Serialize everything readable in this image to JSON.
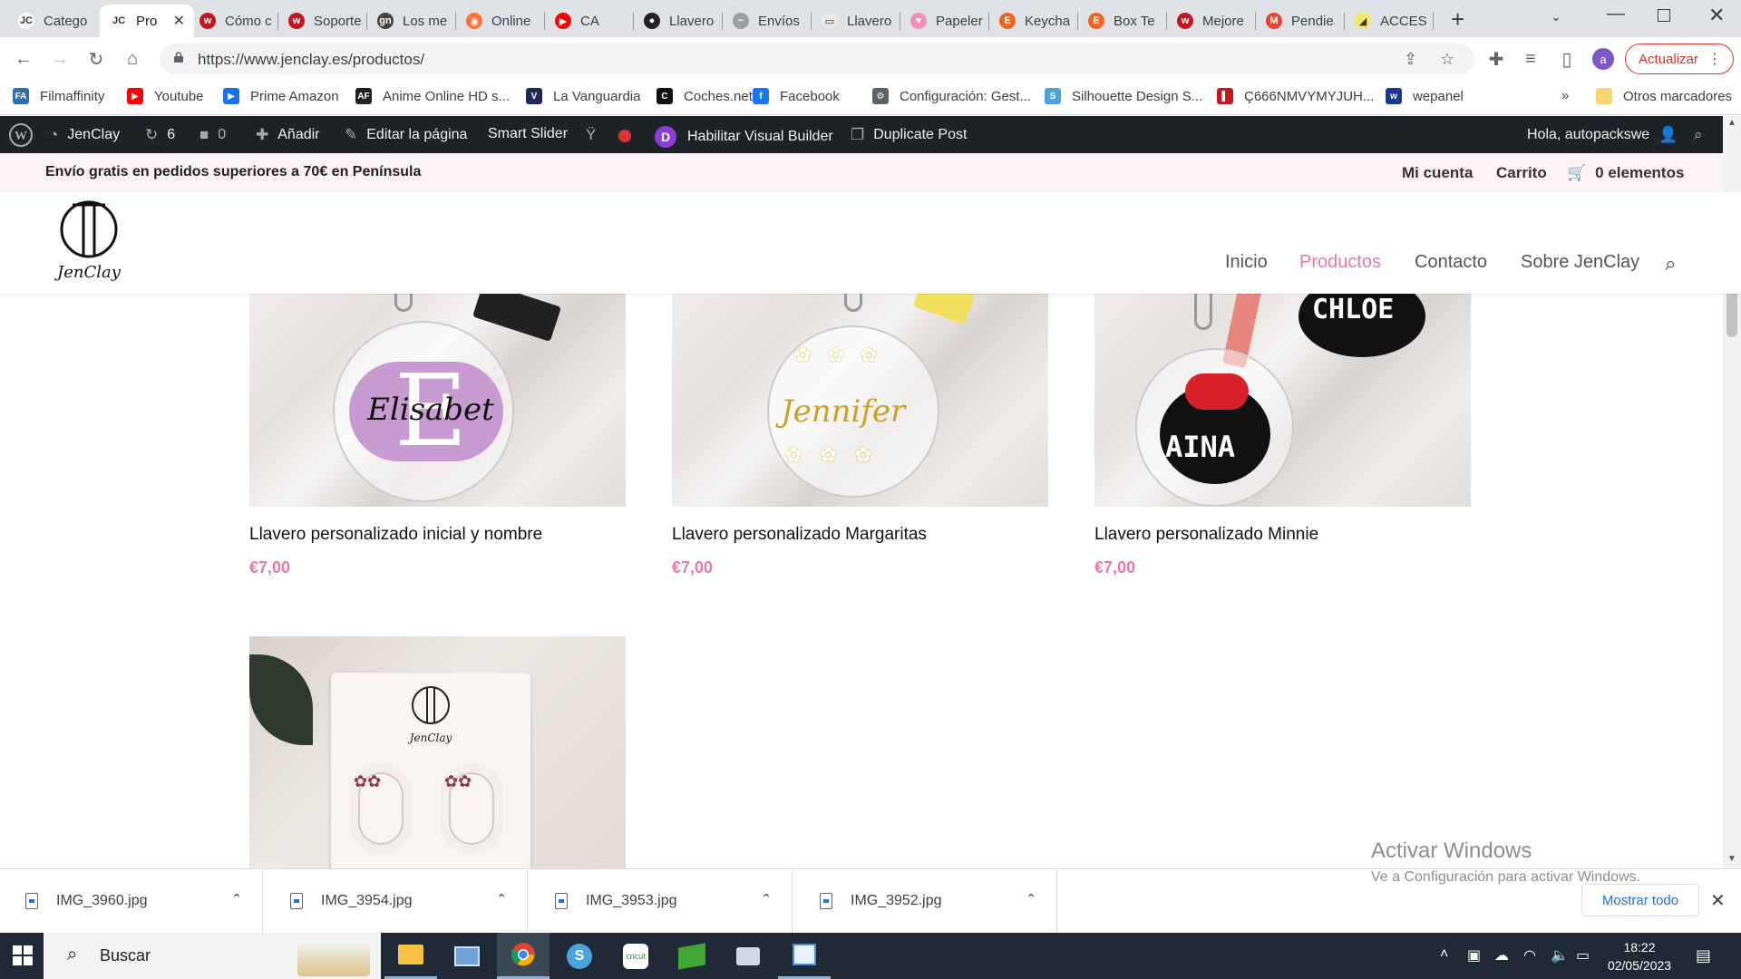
{
  "browser": {
    "tabs": [
      {
        "title": "Catego",
        "color": "#ffffff",
        "glyph": "JC",
        "active": false
      },
      {
        "title": "Pro",
        "color": "#ffffff",
        "glyph": "JC",
        "active": true
      },
      {
        "title": "Cómo c",
        "color": "#c4161c",
        "glyph": "w",
        "active": false
      },
      {
        "title": "Soporte",
        "color": "#c4161c",
        "glyph": "w",
        "active": false
      },
      {
        "title": "Los me",
        "color": "#444444",
        "glyph": "gn",
        "active": false
      },
      {
        "title": "Online",
        "color": "#ff7139",
        "glyph": "◉",
        "active": false
      },
      {
        "title": "CA",
        "color": "#ff0000",
        "glyph": "▶",
        "active": false
      },
      {
        "title": "Llavero",
        "color": "#222222",
        "glyph": "●",
        "active": false
      },
      {
        "title": "Envíos",
        "color": "#9aa0a6",
        "glyph": "~",
        "active": false
      },
      {
        "title": "Llavero",
        "color": "#e8e8e8",
        "glyph": "▭",
        "active": false
      },
      {
        "title": "Papeler",
        "color": "#f48fb1",
        "glyph": "♥",
        "active": false
      },
      {
        "title": "Keycha",
        "color": "#f16521",
        "glyph": "E",
        "active": false
      },
      {
        "title": "Box Te",
        "color": "#f16521",
        "glyph": "E",
        "active": false
      },
      {
        "title": "Mejore",
        "color": "#c4161c",
        "glyph": "w",
        "active": false
      },
      {
        "title": "Pendie",
        "color": "#ea4335",
        "glyph": "M",
        "active": false
      },
      {
        "title": "ACCES",
        "color": "#f5e663",
        "glyph": "◢",
        "active": false
      }
    ],
    "new_tab": "+",
    "url": "https://www.jenclay.es/productos/",
    "update_label": "Actualizar",
    "profile_initial": "a",
    "bookmarks": [
      {
        "label": "Filmaffinity",
        "color": "#2d6db5",
        "glyph": "FA"
      },
      {
        "label": "Youtube",
        "color": "#ff0000",
        "glyph": "▶"
      },
      {
        "label": "Prime Amazon",
        "color": "#1a73e8",
        "glyph": "▶"
      },
      {
        "label": "Anime Online HD s...",
        "color": "#222222",
        "glyph": "AF"
      },
      {
        "label": "La Vanguardia",
        "color": "#1e2a56",
        "glyph": "V"
      },
      {
        "label": "Coches.net",
        "color": "#111111",
        "glyph": "C"
      },
      {
        "label": "Facebook",
        "color": "#1877f2",
        "glyph": "f"
      },
      {
        "label": "Configuración: Gest...",
        "color": "#5f6368",
        "glyph": "⚙"
      },
      {
        "label": "Silhouette Design S...",
        "color": "#4aa3df",
        "glyph": "S"
      },
      {
        "label": "Ç666NMVYMYJUH...",
        "color": "#c4161c",
        "glyph": "▌"
      },
      {
        "label": "wepanel",
        "color": "#1b3a8f",
        "glyph": "w"
      }
    ],
    "bookmarks_more": "»",
    "other_bookmarks": "Otros marcadores"
  },
  "wpbar": {
    "site_name": "JenClay",
    "updates": "6",
    "comments": "0",
    "add_new": "Añadir",
    "edit_page": "Editar la página",
    "smart_slider": "Smart Slider",
    "visual_builder": "Habilitar Visual Builder",
    "duplicate": "Duplicate Post",
    "greeting": "Hola, autopackswe"
  },
  "site": {
    "promo": "Envío gratis en pedidos superiores a 70€ en Península",
    "account": "Mi cuenta",
    "cart": "Carrito",
    "cart_count": "0 elementos",
    "logo_text": "JenClay",
    "menu": [
      {
        "label": "Inicio",
        "active": false
      },
      {
        "label": "Productos",
        "active": true
      },
      {
        "label": "Contacto",
        "active": false
      },
      {
        "label": "Sobre JenClay",
        "active": false
      }
    ],
    "accent": "#e879aa"
  },
  "products": [
    {
      "title": "Llavero personalizado inicial y nombre",
      "price": "€7,00",
      "image_text": "Elisabet",
      "image_letter": "E"
    },
    {
      "title": "Llavero personalizado Margaritas",
      "price": "€7,00",
      "image_text": "Jennifer"
    },
    {
      "title": "Llavero personalizado Minnie",
      "price": "€7,00",
      "image_text": "AINA",
      "image_text2": "CHLOE"
    },
    {
      "title": "",
      "price": "",
      "image_text": "JenClay"
    }
  ],
  "watermark": {
    "line1": "Activar Windows",
    "line2": "Ve a Configuración para activar Windows."
  },
  "downloads": {
    "files": [
      "IMG_3960.jpg",
      "IMG_3954.jpg",
      "IMG_3953.jpg",
      "IMG_3952.jpg"
    ],
    "show_all": "Mostrar todo"
  },
  "taskbar": {
    "search_placeholder": "Buscar",
    "time": "18:22",
    "date": "02/05/2023"
  }
}
